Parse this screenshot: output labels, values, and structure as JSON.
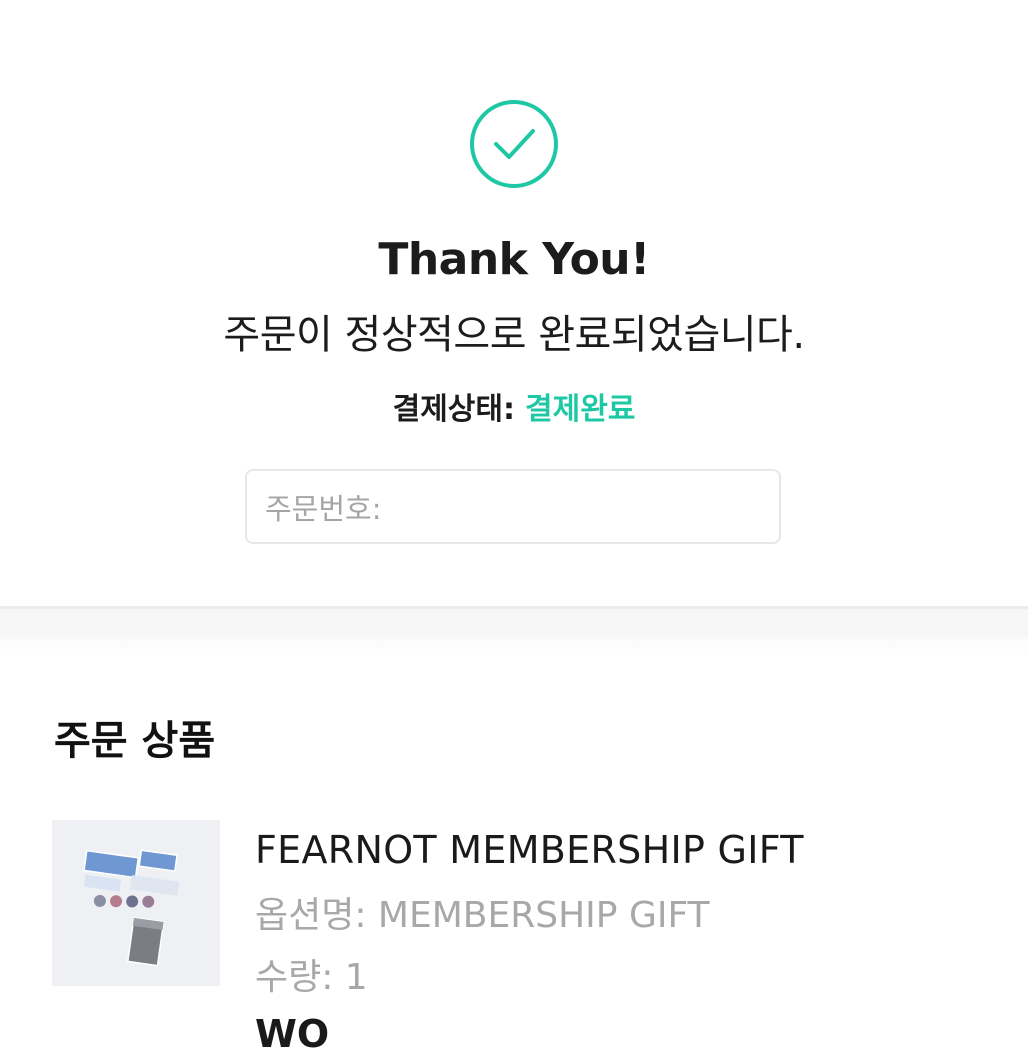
{
  "header": {
    "title_cut": ""
  },
  "result": {
    "icon": "check-circle-icon",
    "accent_color": "#1fc8a4",
    "thanks": "Thank You!",
    "completed_message": "주문이 정상적으로 완료되었습니다.",
    "status_label": "결제상태:",
    "status_value": "결제완료",
    "order_number_label": "주문번호:"
  },
  "order_items": {
    "section_title": "주문 상품",
    "items": [
      {
        "name": "FEARNOT MEMBERSHIP GIFT",
        "option": "옵션명: MEMBERSHIP GIFT",
        "quantity": "수량: 1",
        "next_line_cut": "WO"
      }
    ]
  }
}
